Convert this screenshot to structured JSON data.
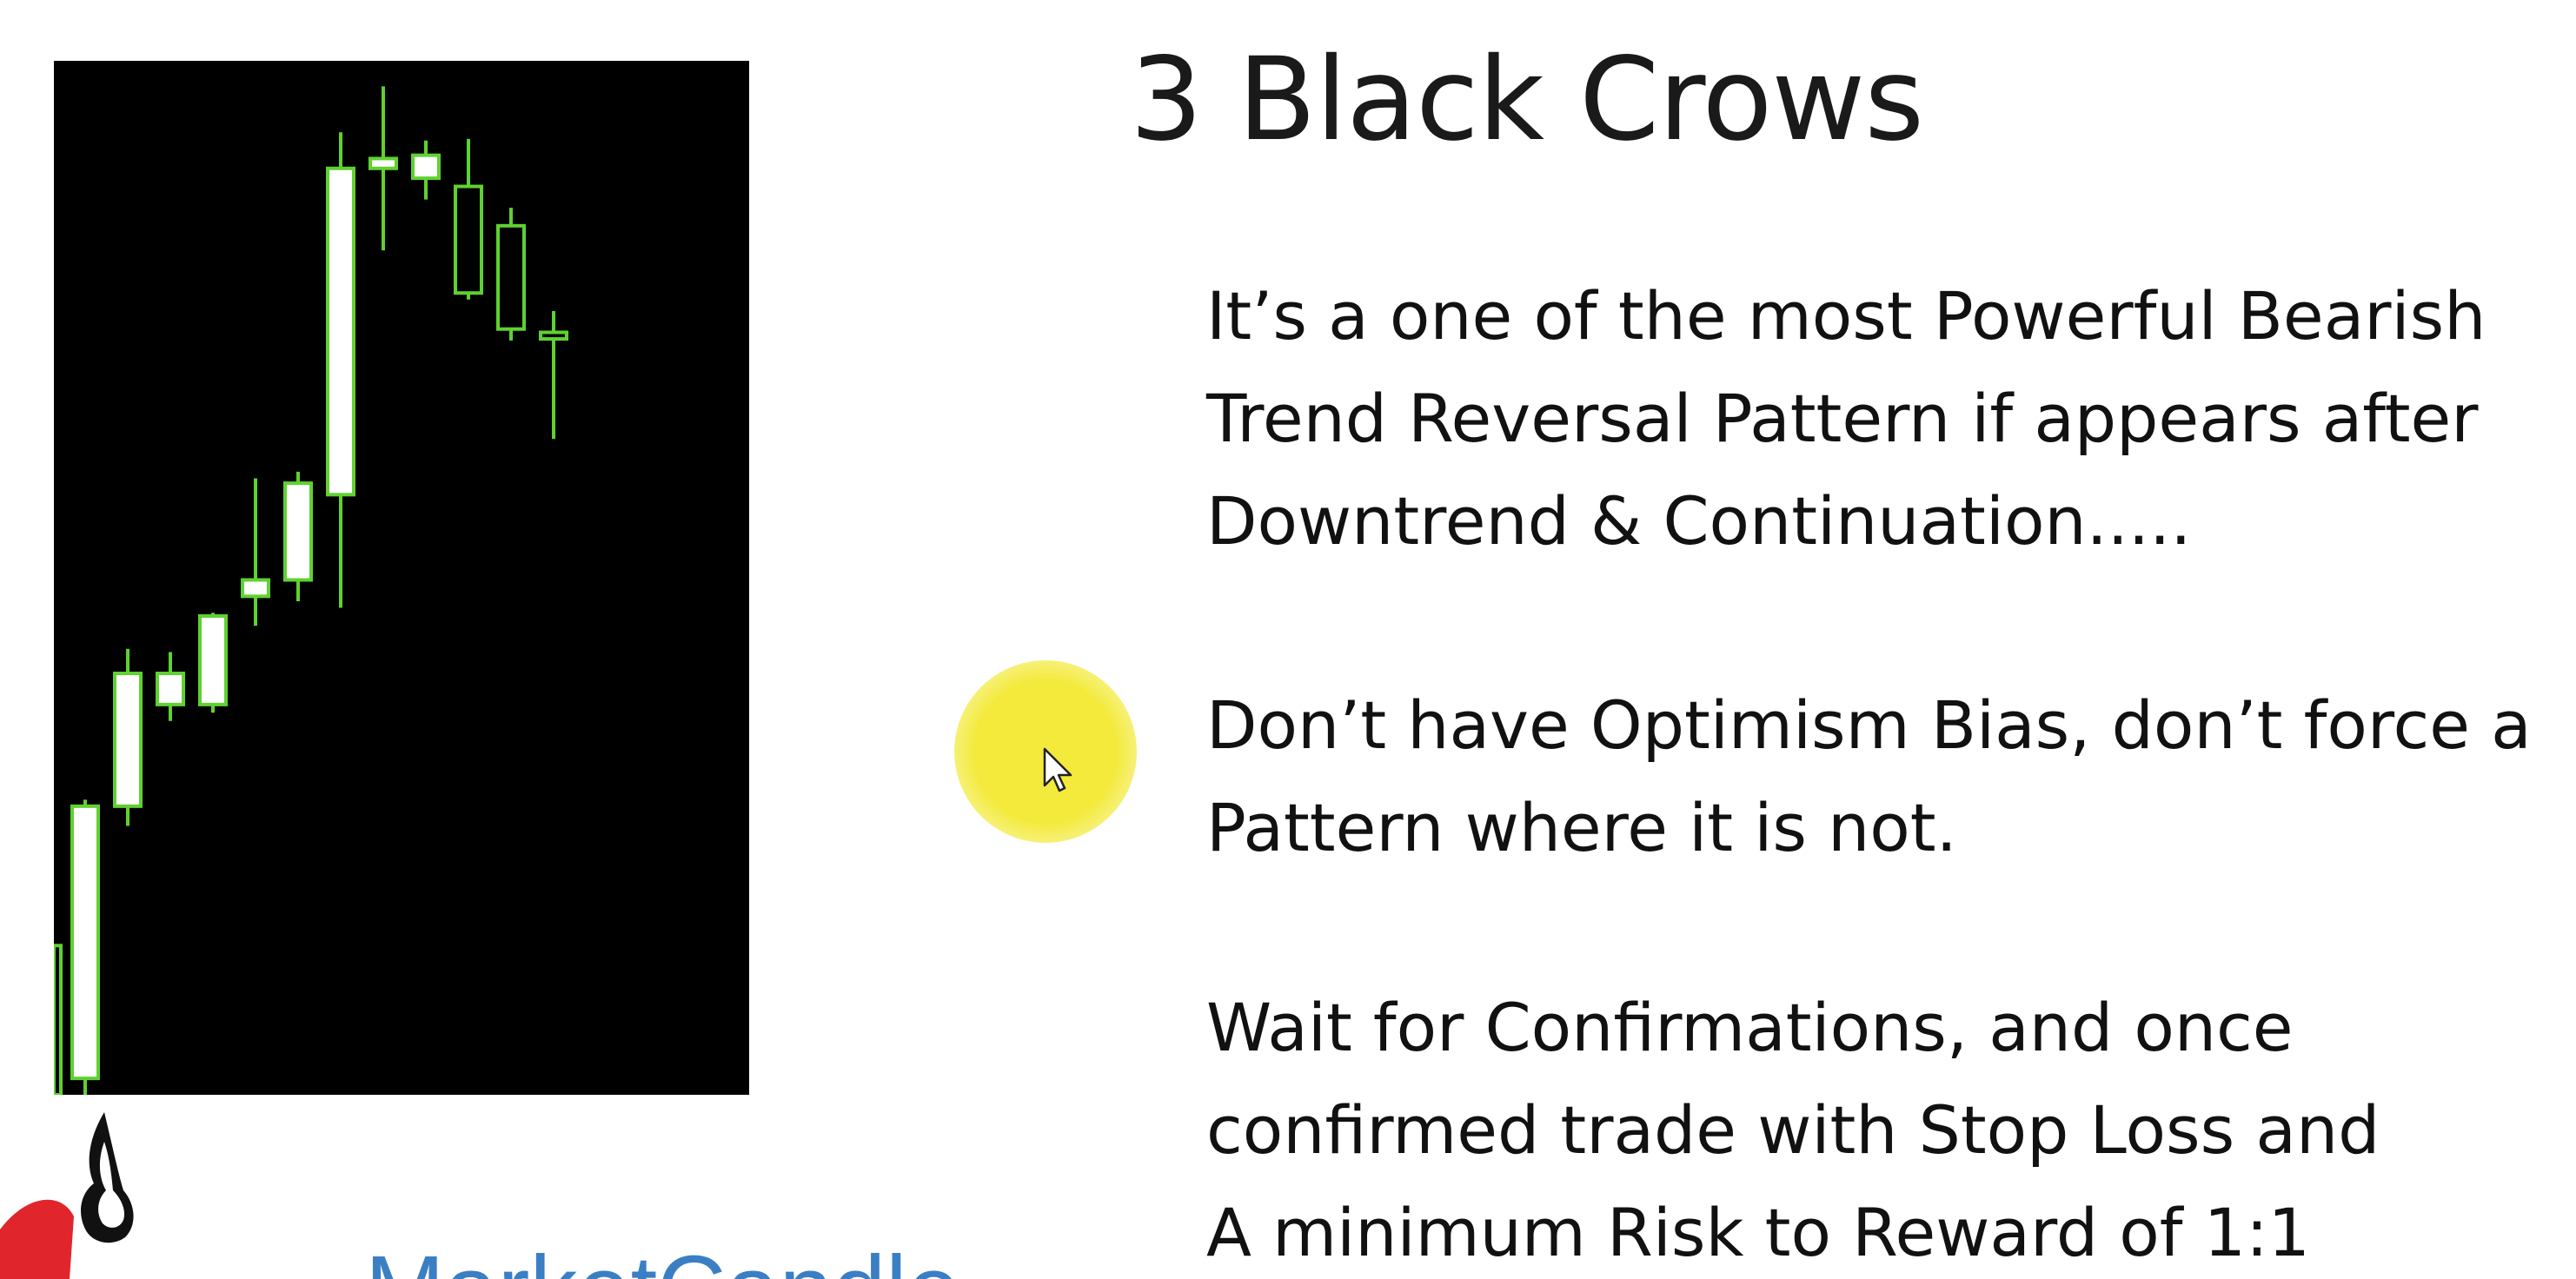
{
  "slide": {
    "title": "3 Black Crows",
    "paragraphs": [
      {
        "lines": [
          "It’s a one of the most Powerful Bearish",
          "Trend Reversal Pattern if appears after",
          "Downtrend & Continuation....."
        ]
      },
      {
        "lines": [
          "Don’t have Optimism Bias, don’t force a",
          "Pattern where it is not."
        ]
      },
      {
        "lines": [
          "Wait for Confirmations, and once",
          "confirmed trade with Stop Loss and",
          "A minimum Risk to Reward of 1:1"
        ]
      }
    ],
    "brand_text": "MarketCandle"
  },
  "colors": {
    "chart_background": "#000000",
    "candle_outline": "#5fd130",
    "bullish_fill": "#ffffff",
    "cursor_highlight": "#f3ea3c",
    "brand_blue": "#3a7fc4",
    "logo_red": "#e0262c"
  },
  "icons": {
    "cursor": "mouse-pointer-icon",
    "logo": "flame-logo-icon"
  },
  "chart_data": {
    "type": "candlestick",
    "background": "black",
    "grid": false,
    "candles": [
      {
        "o": 1.0,
        "h": 18.0,
        "l": 0.0,
        "c": 17.6,
        "bull": true
      },
      {
        "o": 17.6,
        "h": 27.2,
        "l": 16.4,
        "c": 25.7,
        "bull": true
      },
      {
        "o": 23.8,
        "h": 27.0,
        "l": 22.8,
        "c": 25.7,
        "bull": true
      },
      {
        "o": 23.8,
        "h": 29.4,
        "l": 23.3,
        "c": 29.2,
        "bull": true
      },
      {
        "o": 30.4,
        "h": 37.6,
        "l": 28.6,
        "c": 31.4,
        "bull": true
      },
      {
        "o": 31.4,
        "h": 38.0,
        "l": 30.1,
        "c": 37.3,
        "bull": true
      },
      {
        "o": 36.6,
        "h": 58.7,
        "l": 29.7,
        "c": 56.5,
        "bull": true
      },
      {
        "o": 56.5,
        "h": 61.5,
        "l": 51.5,
        "c": 57.1,
        "bull": true
      },
      {
        "o": 55.9,
        "h": 58.2,
        "l": 54.6,
        "c": 57.3,
        "bull": true
      },
      {
        "o": 55.4,
        "h": 58.3,
        "l": 48.5,
        "c": 48.9,
        "bull": false
      },
      {
        "o": 53.0,
        "h": 54.1,
        "l": 46.0,
        "c": 46.7,
        "bull": false
      },
      {
        "o": 46.5,
        "h": 47.8,
        "l": 40.0,
        "c": 46.1,
        "bull": false
      }
    ],
    "partial_left_candle": {
      "o": 0.0,
      "h": 9.1,
      "l": 0.0,
      "c": 9.1,
      "bull": false
    },
    "ylim": [
      0,
      62
    ]
  }
}
